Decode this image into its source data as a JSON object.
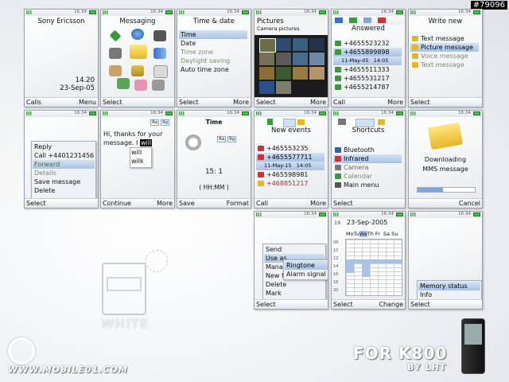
{
  "tag": "#79096",
  "clock": "16:34",
  "standby": {
    "operator": "Sony Ericsson",
    "time": "14.20",
    "date": "23-Sep-05",
    "left": "Calls",
    "right": "Menu"
  },
  "messaging": {
    "title": "Messaging",
    "left": "Select"
  },
  "timedate": {
    "title": "Time & date",
    "items": [
      "Time",
      "Date",
      "Time zone",
      "Daylight saving",
      "Auto time zone"
    ],
    "left": "Select",
    "right": "More"
  },
  "pictures": {
    "title": "Pictures",
    "subtitle": "Camera pictures",
    "left": "Select",
    "right": "More"
  },
  "answered": {
    "title": "Answered",
    "items": [
      "+4655523232",
      "+4655899898",
      "+4655511333",
      "+4655531217",
      "+4655214787"
    ],
    "date": "11-May-05",
    "time": "14:05",
    "left": "Call",
    "right": "More"
  },
  "writenew": {
    "title": "Write new",
    "items": [
      "Text message",
      "Picture message",
      "Voice message",
      "Text message"
    ],
    "left": "Select"
  },
  "callmenu": {
    "items": [
      "Reply",
      "Call +4401231456",
      "Forward",
      "Details",
      "Save message",
      "Delete"
    ],
    "left": "Select"
  },
  "compose": {
    "text": "Hi, thanks for your message. I",
    "word": "will",
    "suggest": [
      "will",
      "wilk"
    ],
    "badge1": "Ra",
    "badge2": "9g",
    "left": "Continue",
    "right": "More"
  },
  "timeset": {
    "title": "Time",
    "badge1": "Ra",
    "badge2": "9g",
    "value": "15: 1",
    "format": "( HH:MM )",
    "left": "Save",
    "right": "Format"
  },
  "newevents": {
    "title": "New events",
    "items": [
      "+465553235",
      "+4655577711",
      "+465598981",
      "+468851217"
    ],
    "date": "11-May-15",
    "time": "14:05",
    "left": "Call",
    "right": "More"
  },
  "shortcuts": {
    "title": "Shortcuts",
    "items": [
      "Bluetooth",
      "Infrared",
      "Camera",
      "Calendar",
      "Main menu"
    ],
    "left": "Select"
  },
  "download": {
    "line1": "Downloading",
    "line2": "MMS message",
    "progress": 0.45,
    "right": "Cancel"
  },
  "options": {
    "items": [
      "Send",
      "Use as",
      "Manage",
      "New f",
      "Delete",
      "Mark"
    ],
    "sub": [
      "Ringtone",
      "Alarm signal"
    ],
    "left": "Select"
  },
  "calendar": {
    "week": "19",
    "date": "23-Sep-2005",
    "days": [
      "Mo",
      "Tu",
      "We",
      "Th",
      "Fr",
      "Sa",
      "Su"
    ],
    "hours": [
      "08",
      "10",
      "12",
      "14",
      "16",
      "18",
      "20"
    ],
    "left": "Select",
    "right": "Change"
  },
  "memory": {
    "items": [
      "Memory status",
      "Info"
    ],
    "left": "Select"
  },
  "branding": {
    "white": "WHITE",
    "for": "FOR K800",
    "by": "BY LHT",
    "site": "WWW.MOBILE01.COM"
  },
  "colors": {
    "accent": "#a9c2e4",
    "softbar": "#dfe4e9",
    "green": "#3a8a3a"
  }
}
